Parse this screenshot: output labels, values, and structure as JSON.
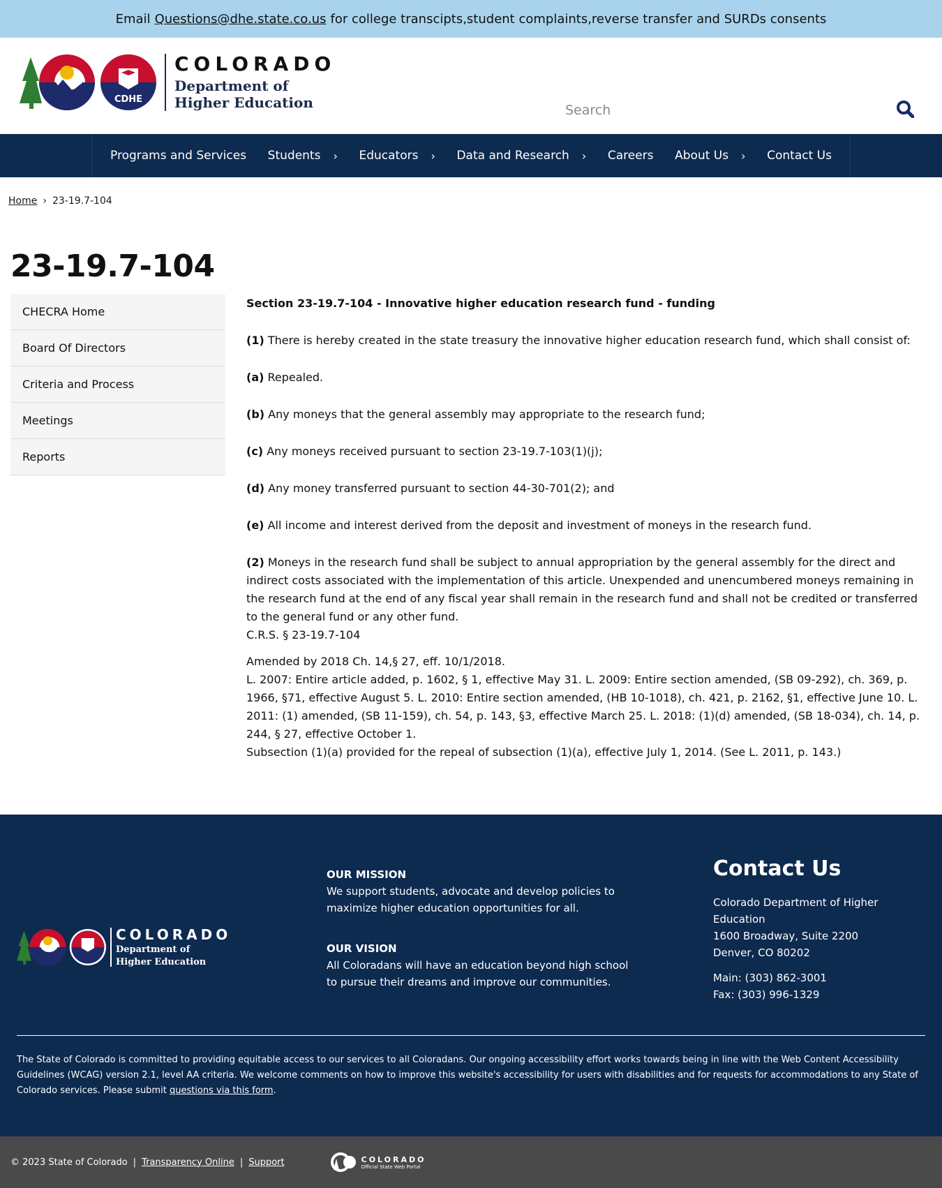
{
  "alert": {
    "prefix": "Email",
    "email": "Questions@dhe.state.co.us",
    "suffix": "for college transcipts,student complaints,reverse transfer and SURDs consents"
  },
  "header": {
    "logo": {
      "state": "COLORADO",
      "dept_line1": "Department of",
      "dept_line2": "Higher Education",
      "badge": "CDHE"
    },
    "search_placeholder": "Search"
  },
  "nav": [
    {
      "label": "Programs and Services",
      "chevron": false
    },
    {
      "label": "Students",
      "chevron": true
    },
    {
      "label": "Educators",
      "chevron": true
    },
    {
      "label": "Data and Research",
      "chevron": true
    },
    {
      "label": "Careers",
      "chevron": false
    },
    {
      "label": "About Us",
      "chevron": true
    },
    {
      "label": "Contact Us",
      "chevron": false
    }
  ],
  "breadcrumb": {
    "home": "Home",
    "separator": "›",
    "current": "23-19.7-104"
  },
  "page_title": "23-19.7-104",
  "sidenav": [
    "CHECRA Home",
    "Board Of Directors",
    "Criteria and Process",
    "Meetings",
    "Reports"
  ],
  "body": {
    "heading": "Section 23-19.7-104 - Innovative higher education research fund - funding",
    "paragraphs": [
      {
        "num": "(1)",
        "text": "There is hereby created in the state treasury the innovative higher education research fund, which shall consist of:"
      },
      {
        "num": "(a)",
        "text": "Repealed."
      },
      {
        "num": "(b)",
        "text": "Any moneys that the general assembly may appropriate to the research fund;"
      },
      {
        "num": "(c)",
        "text": "Any moneys received pursuant to section 23-19.7-103(1)(j);"
      },
      {
        "num": "(d)",
        "text": "Any money transferred pursuant to section 44-30-701(2); and"
      },
      {
        "num": "(e)",
        "text": "All income and interest derived from the deposit and investment of moneys in the research fund."
      },
      {
        "num": "(2)",
        "text": "Moneys in the research fund shall be subject to annual appropriation by the general assembly for the direct and indirect costs associated with the implementation of this article. Unexpended and unencumbered moneys remaining in the research fund at the end of any fiscal year shall remain in the research fund and shall not be credited or transferred to the general fund or any other fund."
      }
    ],
    "citation": "C.R.S. § 23-19.7-104",
    "amended": "Amended by 2018 Ch. 14,§ 27, eff. 10/1/2018.",
    "history": "L. 2007: Entire article added, p. 1602, § 1, effective May 31. L. 2009: Entire section amended, (SB 09-292), ch. 369, p. 1966, §71, effective August 5. L. 2010: Entire section amended, (HB 10-1018), ch. 421, p. 2162, §1, effective June 10. L. 2011: (1) amended, (SB 11-159), ch. 54, p. 143, §3, effective March 25. L. 2018: (1)(d) amended, (SB 18-034), ch. 14, p. 244, § 27, effective October 1.",
    "subsection_note": "Subsection (1)(a) provided for the repeal of subsection (1)(a), effective July 1, 2014. (See L. 2011, p. 143.)"
  },
  "footer": {
    "mission_label": "OUR MISSION",
    "mission_text": "We support students, advocate and develop policies to maximize higher education opportunities for all.",
    "vision_label": "OUR VISION",
    "vision_text": "All Coloradans will have an education beyond high school to pursue their dreams and improve our communities.",
    "contact_heading": "Contact Us",
    "address1": "Colorado Department of Higher Education",
    "address2": "1600 Broadway, Suite 2200",
    "address3": "Denver, CO 80202",
    "main_phone": "Main: (303) 862-3001",
    "fax": "Fax: (303) 996-1329",
    "accessibility_text": "The State of Colorado is committed to providing equitable access to our services to all Coloradans. Our ongoing accessibility effort works towards being in line with the Web Content Accessibility Guidelines (WCAG) version 2.1, level AA criteria. We welcome comments on how to improve this website's accessibility for users with disabilities and for requests for accommodations to any State of Colorado services. Please submit",
    "accessibility_link": "questions via this form",
    "accessibility_end": "."
  },
  "bottom": {
    "copyright": "© 2023 State of Colorado",
    "sep": "|",
    "transparency": "Transparency Online",
    "support": "Support",
    "portal_name": "COLORADO",
    "portal_sub": "Official State Web Portal"
  },
  "colors": {
    "alert_bg": "#a9d3ec",
    "nav_bg": "#0d2a4f",
    "footer_bg": "#0d2a4f",
    "bottom_bg": "#4a4a4a",
    "search_icon": "#1a2a6c"
  }
}
